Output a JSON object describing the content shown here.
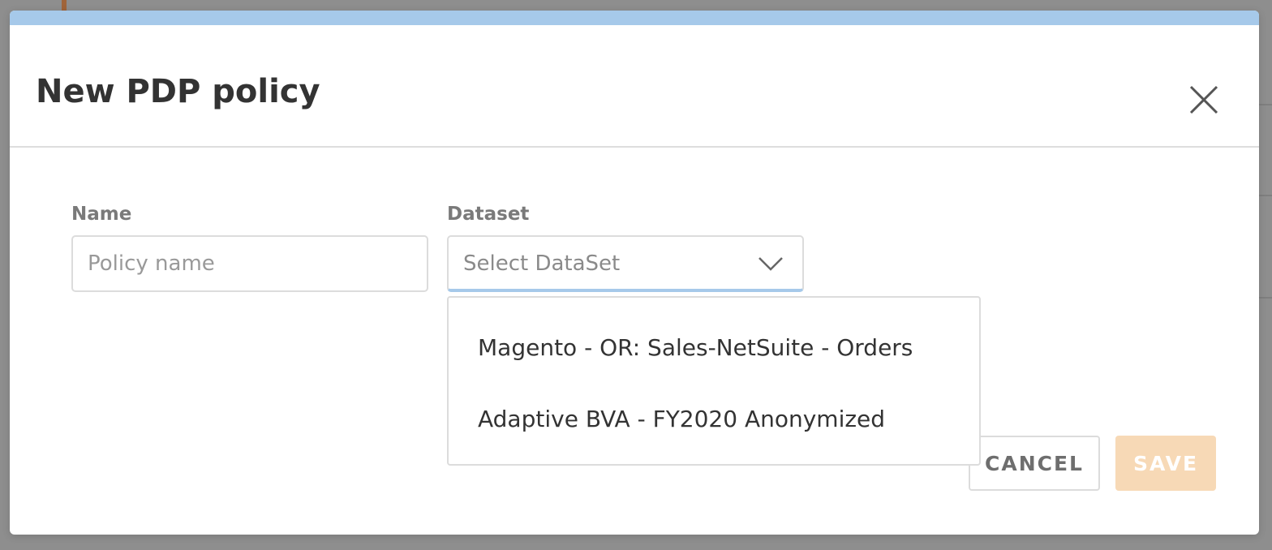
{
  "modal": {
    "title": "New PDP policy",
    "accent_color": "#a6c9ea"
  },
  "form": {
    "name_label": "Name",
    "name_placeholder": "Policy name",
    "name_value": "",
    "dataset_label": "Dataset",
    "dataset_placeholder": "Select DataSet",
    "dataset_options": [
      "Magento - OR: Sales-NetSuite - Orders",
      "Adaptive BVA - FY2020 Anonymized"
    ]
  },
  "actions": {
    "cancel_label": "CANCEL",
    "save_label": "SAVE",
    "save_color": "#f7d9b6"
  }
}
